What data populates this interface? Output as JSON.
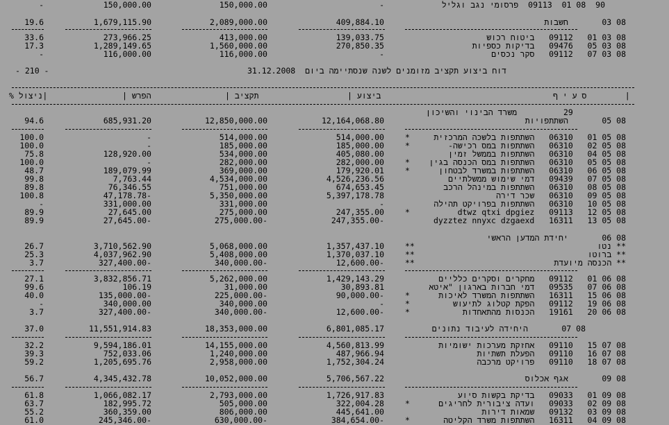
{
  "top_row": {
    "pct": "-",
    "diff": "150,000.00",
    "budget": "150,000.00",
    "exec": "-",
    "desc": "90  08 01  09113  פרסומי נגב וגליל"
  },
  "group_03": {
    "pct": "19.6",
    "diff": "1,679,115.90",
    "budget": "2,089,000.00",
    "exec": "409,884.10",
    "desc": "08 03       חשבות"
  },
  "group_03_items": [
    {
      "pct": "33.6",
      "diff": "273,966.25",
      "budget": "413,000.00",
      "exec": "139,033.75",
      "mark": "",
      "desc": "08 03 01   09112   ביטוח רכוש"
    },
    {
      "pct": "17.3",
      "diff": "1,289,149.65",
      "budget": "1,560,000.00",
      "exec": "270,850.35",
      "mark": "",
      "desc": "08 03 05   09476   בדיקות כספיות"
    },
    {
      "pct": "-",
      "diff": "116,000.00",
      "budget": "116,000.00",
      "exec": "-",
      "mark": "",
      "desc": "08 03 07   09112   סקר נכסים"
    }
  ],
  "report_header": {
    "page": "- 210 -",
    "title": "דוח ביצוע תקציב מזומנים לשנה שנסתיימה ביום  31.12.2008"
  },
  "columns": {
    "pct": "% ניצול|",
    "diff": "| הפרש",
    "budget": "| תקציב",
    "exec": "| ביצוע",
    "section": "|        ס ע י ף"
  },
  "ministry": {
    "code": "29",
    "name": "משרד הבינוי והשיכון"
  },
  "group_05": {
    "pct": "94.6",
    "diff": "685,931.20",
    "budget": "12,850,000.00",
    "exec": "12,164,068.80",
    "desc": "08 05       השתתפויות"
  },
  "group_05_items": [
    {
      "pct": "100.0",
      "diff": "-",
      "budget": "514,000.00",
      "exec": "514,000.00",
      "mark": "*",
      "desc": "08 05 01   06310   השתתפות בלשכה המרכזית"
    },
    {
      "pct": "100.0",
      "diff": "-",
      "budget": "185,000.00",
      "exec": "185,000.00",
      "mark": "*",
      "desc": "08 05 02   06310   השתתפות במס רכישה-"
    },
    {
      "pct": "75.8",
      "diff": "128,920.00",
      "budget": "534,000.00",
      "exec": "405,080.00",
      "mark": "",
      "desc": "08 05 04   06310   השתתפות בממשל זמין"
    },
    {
      "pct": "100.0",
      "diff": "-",
      "budget": "282,000.00",
      "exec": "282,000.00",
      "mark": "*",
      "desc": "08 05 05   06310   השתתפות במס הכנסה בגין"
    },
    {
      "pct": "48.7",
      "diff": "189,079.99",
      "budget": "369,000.00",
      "exec": "179,920.01",
      "mark": "*",
      "desc": "08 05 06   06310   השתתפות במשרד לבטחון"
    },
    {
      "pct": "99.8",
      "diff": "7,763.44",
      "budget": "4,534,000.00",
      "exec": "4,526,236.56",
      "mark": "",
      "desc": "08 05 07   09439   דמי שימוש ממשלתיים"
    },
    {
      "pct": "89.8",
      "diff": "76,346.55",
      "budget": "751,000.00",
      "exec": "674,653.45",
      "mark": "",
      "desc": "08 05 08   06310   השתתפות במינהל הרכב"
    },
    {
      "pct": "100.8",
      "diff": "47,178.78-",
      "budget": "5,350,000.00",
      "exec": "5,397,178.78",
      "mark": "",
      "desc": "08 05 09   06310   שכר דירה"
    },
    {
      "pct": "-",
      "diff": "331,000.00",
      "budget": "331,000.00",
      "exec": "-",
      "mark": "",
      "desc": "08 05 10   06310   השתתפות בפרויקט תהילה"
    },
    {
      "pct": "89.9",
      "diff": "27,645.00",
      "budget": "275,000.00",
      "exec": "247,355.00",
      "mark": "*",
      "desc": "08 05 12   09113   dtwz qtxi dpgiez"
    },
    {
      "pct": "89.9",
      "diff": "27,645.00-",
      "budget": "275,000.00-",
      "exec": "247,355.00-",
      "mark": "",
      "desc": "08 05 13   16311   dyzztez nnyxc dzgaexd"
    }
  ],
  "group_06": {
    "desc": "08 06       יחידת המדען הראשי"
  },
  "group_06_totals": [
    {
      "pct": "26.7",
      "diff": "3,710,562.90",
      "budget": "5,068,000.00",
      "exec": "1,357,437.10",
      "mark": "**",
      "desc": "** נטו"
    },
    {
      "pct": "25.3",
      "diff": "4,037,962.90",
      "budget": "5,408,000.00",
      "exec": "1,370,037.10",
      "mark": "**",
      "desc": "** ברוטו"
    },
    {
      "pct": "3.7",
      "diff": "327,400.00-",
      "budget": "340,000.00-",
      "exec": "12,600.00-",
      "mark": "**",
      "desc": "** הכנסה מיועדת"
    }
  ],
  "group_06_items": [
    {
      "pct": "27.1",
      "diff": "3,832,856.71",
      "budget": "5,262,000.00",
      "exec": "1,429,143.29",
      "mark": "",
      "desc": "08 06 01   09112   מחקרים וסקרים כלליים"
    },
    {
      "pct": "99.6",
      "diff": "106.19",
      "budget": "31,000.00",
      "exec": "30,893.81",
      "mark": "",
      "desc": "08 06 07   09535   דמי חברות בארגון \"איטא"
    },
    {
      "pct": "40.0",
      "diff": "135,000.00-",
      "budget": "225,000.00-",
      "exec": "90,000.00-",
      "mark": "*",
      "desc": "08 06 15   16311   השתתפות המשרד לאיכות"
    },
    {
      "pct": "-",
      "diff": "340,000.00",
      "budget": "340,000.00",
      "exec": "-",
      "mark": "*",
      "desc": "08 06 19   09112   הפקת קטלוג לתיעוש"
    },
    {
      "pct": "3.7",
      "diff": "327,400.00-",
      "budget": "340,000.00-",
      "exec": "12,600.00-",
      "mark": "*",
      "desc": "08 06 20   19161   הכנסות מהתאחדות"
    }
  ],
  "group_07": {
    "pct": "37.0",
    "diff": "11,551,914.83",
    "budget": "18,353,000.00",
    "exec": "6,801,085.17",
    "desc": "08 07       היחידה לעיבוד נתונים"
  },
  "group_07_items": [
    {
      "pct": "32.2",
      "diff": "9,594,186.01",
      "budget": "14,155,000.00",
      "exec": "4,560,813.99",
      "mark": "",
      "desc": "08 07 15   09110   אחזקת מערכות ישומיות"
    },
    {
      "pct": "39.3",
      "diff": "752,033.06",
      "budget": "1,240,000.00",
      "exec": "487,966.94",
      "mark": "",
      "desc": "08 07 16   09110   הפעלת תשתיות"
    },
    {
      "pct": "59.2",
      "diff": "1,205,695.76",
      "budget": "2,958,000.00",
      "exec": "1,752,304.24",
      "mark": "",
      "desc": "08 07 18   09110   פרויקט מרכבה"
    }
  ],
  "group_09": {
    "pct": "56.7",
    "diff": "4,345,432.78",
    "budget": "10,052,000.00",
    "exec": "5,706,567.22",
    "desc": "08 09       אגף אכלוס"
  },
  "group_09_items": [
    {
      "pct": "61.8",
      "diff": "1,066,082.17",
      "budget": "2,793,000.00",
      "exec": "1,726,917.83",
      "mark": "",
      "desc": "08 09 01   09033   בדיקת בקשות סיוע"
    },
    {
      "pct": "63.7",
      "diff": "182,995.72",
      "budget": "505,000.00",
      "exec": "322,004.28",
      "mark": "*",
      "desc": "08 09 02   09033   ועדה ציבורית לחריגים"
    },
    {
      "pct": "55.2",
      "diff": "360,359.00",
      "budget": "806,000.00",
      "exec": "445,641.00",
      "mark": "",
      "desc": "08 09 03   09132   שמאות דירות"
    },
    {
      "pct": "61.0",
      "diff": "245,346.00-",
      "budget": "630,000.00-",
      "exec": "384,654.00-",
      "mark": "*",
      "desc": "08 09 04   16311   השתתפות משרד הקליטה"
    }
  ]
}
